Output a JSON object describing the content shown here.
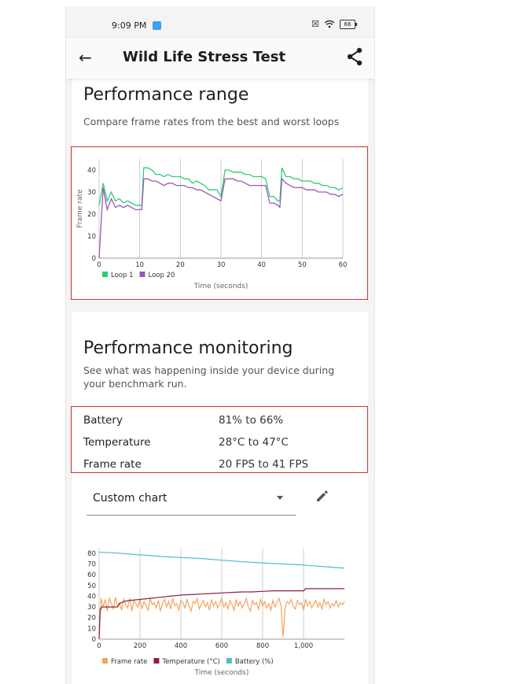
{
  "status_bar": {
    "time": "9:09 PM",
    "battery": "66"
  },
  "app_bar": {
    "title": "Wild Life Stress Test",
    "back_icon": "arrow-back-icon",
    "share_icon": "share-icon"
  },
  "performance_range": {
    "title": "Performance range",
    "subtitle": "Compare frame rates from the best and worst loops",
    "highlight_color": "#d32f2f"
  },
  "performance_monitoring": {
    "title": "Performance monitoring",
    "subtitle": "See what was happening inside your device during your benchmark run.",
    "metrics": [
      {
        "label": "Battery",
        "value": "81% to 66%"
      },
      {
        "label": "Temperature",
        "value": "28°C to 47°C"
      },
      {
        "label": "Frame rate",
        "value": "20 FPS to 41 FPS"
      }
    ],
    "chart_selector": {
      "selected": "Custom chart",
      "edit_icon": "pencil-icon"
    }
  },
  "chart_data": [
    {
      "type": "line",
      "xlabel": "Time (seconds)",
      "ylabel": "Frame rate",
      "xlim": [
        0,
        60
      ],
      "ylim": [
        0,
        45
      ],
      "x_ticks": [
        "0",
        "10",
        "20",
        "30",
        "40",
        "50",
        "60"
      ],
      "y_ticks": [
        "0",
        "10",
        "20",
        "30",
        "40"
      ],
      "vertical_grid_at": [
        0,
        10,
        20,
        30,
        40,
        50,
        60
      ],
      "legend_position": "bottom-left",
      "series": [
        {
          "name": "Loop 1",
          "color": "#2ecc71",
          "x": [
            0,
            1,
            2,
            3,
            4,
            5,
            6,
            7,
            8,
            9,
            10,
            10.5,
            11,
            12,
            13,
            14,
            15,
            16,
            17,
            18,
            19,
            20,
            21,
            22,
            23,
            24,
            25,
            26,
            27,
            28,
            29,
            30,
            31,
            32,
            33,
            34,
            35,
            36,
            37,
            38,
            39,
            40,
            41,
            42,
            43,
            44,
            44.5,
            45,
            46,
            47,
            48,
            49,
            50,
            51,
            52,
            53,
            54,
            55,
            56,
            57,
            58,
            59,
            60
          ],
          "y": [
            24,
            34,
            26,
            30,
            26,
            27,
            25,
            26,
            25,
            24,
            24,
            24,
            41,
            41,
            40,
            38,
            38,
            37,
            38,
            37,
            37,
            37,
            36,
            36,
            34,
            35,
            34,
            33,
            31,
            31,
            31,
            28,
            40,
            40,
            39,
            39,
            39,
            38,
            38,
            37,
            37,
            37,
            36,
            28,
            28,
            26,
            26,
            41,
            37,
            37,
            36,
            36,
            35,
            35,
            35,
            34,
            34,
            33,
            33,
            32,
            32,
            31,
            32
          ]
        },
        {
          "name": "Loop 20",
          "color": "#9b59b6",
          "x": [
            0,
            1,
            2,
            3,
            4,
            5,
            6,
            7,
            8,
            9,
            10,
            10.5,
            11,
            12,
            13,
            14,
            15,
            16,
            17,
            18,
            19,
            20,
            21,
            22,
            23,
            24,
            25,
            26,
            27,
            28,
            29,
            30,
            31,
            32,
            33,
            34,
            35,
            36,
            37,
            38,
            39,
            40,
            41,
            42,
            43,
            44,
            44.5,
            45,
            46,
            47,
            48,
            49,
            50,
            51,
            52,
            53,
            54,
            55,
            56,
            57,
            58,
            59,
            60
          ],
          "y": [
            0,
            32,
            22,
            27,
            23,
            24,
            23,
            24,
            23,
            22,
            22,
            22,
            36,
            36,
            35,
            35,
            34,
            33,
            34,
            34,
            33,
            33,
            33,
            32,
            32,
            31,
            31,
            30,
            29,
            28,
            27,
            26,
            36,
            36,
            36,
            35,
            35,
            34,
            33,
            33,
            33,
            33,
            33,
            25,
            25,
            24,
            23,
            36,
            34,
            33,
            32,
            32,
            32,
            31,
            31,
            31,
            30,
            30,
            30,
            29,
            29,
            28,
            29
          ]
        }
      ]
    },
    {
      "type": "line",
      "xlabel": "Time (seconds)",
      "xlim": [
        0,
        1200
      ],
      "ylim": [
        0,
        85
      ],
      "x_ticks": [
        "0",
        "200",
        "400",
        "600",
        "800",
        "1,000"
      ],
      "y_ticks": [
        "0",
        "10",
        "20",
        "30",
        "40",
        "50",
        "60",
        "70",
        "80"
      ],
      "vertical_grid_at": [
        0,
        200,
        400,
        600,
        800,
        1000
      ],
      "legend_position": "bottom",
      "series": [
        {
          "name": "Frame rate",
          "color": "#f4a460",
          "x": [
            0,
            10,
            20,
            30,
            40,
            50,
            60,
            70,
            80,
            90,
            100,
            110,
            120,
            130,
            140,
            150,
            160,
            170,
            180,
            190,
            200,
            210,
            220,
            230,
            240,
            250,
            260,
            270,
            280,
            290,
            300,
            310,
            320,
            330,
            340,
            350,
            360,
            370,
            380,
            390,
            400,
            410,
            420,
            430,
            440,
            450,
            460,
            470,
            480,
            490,
            500,
            510,
            520,
            530,
            540,
            550,
            560,
            570,
            580,
            590,
            600,
            610,
            620,
            630,
            640,
            650,
            660,
            670,
            680,
            690,
            700,
            710,
            720,
            730,
            740,
            750,
            760,
            770,
            780,
            790,
            800,
            810,
            820,
            830,
            840,
            850,
            860,
            870,
            880,
            890,
            900,
            910,
            920,
            930,
            940,
            950,
            960,
            970,
            980,
            990,
            1000,
            1010,
            1020,
            1030,
            1040,
            1050,
            1060,
            1070,
            1080,
            1090,
            1100,
            1110,
            1120,
            1130,
            1140,
            1150,
            1160,
            1170,
            1180,
            1190,
            1200
          ],
          "y": [
            0,
            38,
            30,
            37,
            26,
            38,
            33,
            28,
            39,
            31,
            34,
            27,
            37,
            32,
            29,
            38,
            26,
            36,
            33,
            30,
            37,
            28,
            35,
            31,
            27,
            38,
            32,
            34,
            29,
            36,
            26,
            33,
            37,
            30,
            35,
            28,
            38,
            31,
            33,
            27,
            36,
            34,
            29,
            37,
            31,
            26,
            35,
            33,
            38,
            28,
            32,
            36,
            30,
            34,
            27,
            37,
            31,
            35,
            29,
            33,
            38,
            30,
            34,
            28,
            36,
            32,
            27,
            37,
            31,
            35,
            29,
            33,
            38,
            30,
            26,
            36,
            32,
            34,
            28,
            37,
            31,
            35,
            29,
            33,
            27,
            36,
            30,
            34,
            38,
            31,
            2,
            29,
            35,
            33,
            37,
            30,
            28,
            36,
            32,
            34,
            27,
            37,
            31,
            35,
            29,
            33,
            36,
            30,
            34,
            28,
            37,
            32,
            35,
            29,
            33,
            31,
            36,
            30,
            34,
            32,
            35
          ],
          "legend_label": "Frame rate"
        },
        {
          "name": "Temperature (°C)",
          "color": "#8b2240",
          "x": [
            0,
            5,
            10,
            12,
            90,
            100,
            120,
            150,
            200,
            250,
            300,
            350,
            400,
            450,
            500,
            550,
            600,
            650,
            700,
            750,
            800,
            850,
            900,
            950,
            1000,
            1010,
            1050,
            1100,
            1150,
            1200
          ],
          "y": [
            0,
            28,
            28,
            30,
            30,
            33,
            35,
            36,
            37,
            38,
            39,
            40,
            41,
            41.5,
            42,
            42.5,
            43,
            43.5,
            44,
            44,
            44.5,
            45,
            45,
            45,
            45,
            47,
            47,
            47,
            47,
            47
          ]
        },
        {
          "name": "Battery (%)",
          "color": "#4fbcc8",
          "x": [
            0,
            100,
            200,
            300,
            400,
            500,
            600,
            700,
            800,
            900,
            1000,
            1100,
            1200
          ],
          "y": [
            81,
            80,
            78.5,
            77,
            76,
            75,
            73.5,
            72,
            71,
            70,
            69,
            67.5,
            66
          ]
        }
      ]
    }
  ]
}
